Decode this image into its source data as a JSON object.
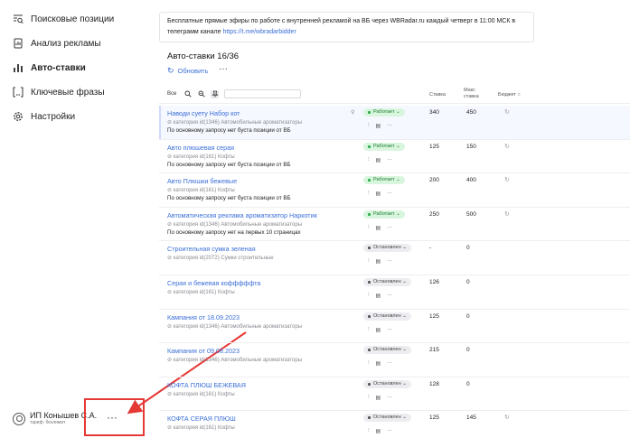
{
  "sidebar": {
    "items": [
      {
        "label": "Поисковые позиции",
        "icon": "search-list-icon"
      },
      {
        "label": "Анализ рекламы",
        "icon": "chart-doc-icon"
      },
      {
        "label": "Авто-ставки",
        "icon": "bar-chart-icon",
        "active": true
      },
      {
        "label": "Ключевые фразы",
        "icon": "brackets-icon"
      },
      {
        "label": "Настройки",
        "icon": "gear-icon"
      }
    ],
    "user": {
      "name": "ИП Конышев С.А.",
      "plan": "тариф: безлимит",
      "more": "···"
    }
  },
  "banner": {
    "text": "Бесплатные прямые эфиры по работе с внутренней рекламой на ВБ через WBRadar.ru каждый четверг в 11:00 МСК в телеграмм канале ",
    "link": "https://t.me/wbradarbidder"
  },
  "page": {
    "title": "Авто-ставки 16/36",
    "refresh": "Обновить",
    "more": "···",
    "filter_all": "Все"
  },
  "columns": {
    "bid": "Ставка",
    "max_bid_1": "Макс",
    "max_bid_2": "ставка",
    "budget": "Бюджет"
  },
  "rows": [
    {
      "name": "Наводи суету Набор кот",
      "category": "категория id(1346) Автомобильные ароматизаторы",
      "note": "По основному запросу нет буста позиции от ВБ",
      "status": "Работает",
      "running": true,
      "bid": "340",
      "max_bid": "450",
      "pinned": true
    },
    {
      "name": "Авто плюшевая серая",
      "category": "категория id(161) Кофты",
      "note": "По основному запросу нет буста позиции от ВБ",
      "status": "Работает",
      "running": true,
      "bid": "125",
      "max_bid": "150"
    },
    {
      "name": "Авто Плюшки бежевые",
      "category": "категория id(161) Кофты",
      "note": "По основному запросу нет буста позиции от ВБ",
      "status": "Работает",
      "running": true,
      "bid": "200",
      "max_bid": "400"
    },
    {
      "name": "Автоматическая реклама ароматизатор Наркотик",
      "category": "категория id(1346) Автомобильные ароматизаторы",
      "note": "По основному запросу нет на первых 10 страницах",
      "status": "Работает",
      "running": true,
      "bid": "250",
      "max_bid": "500"
    },
    {
      "name": "Строительная сумка зеленая",
      "category": "категория id(2072) Сумки строительные",
      "note": "",
      "status": "Остановлен",
      "running": false,
      "bid": "-",
      "max_bid": "0"
    },
    {
      "name": "Серая и бежевая кофффффта",
      "category": "категория id(161) Кофты",
      "note": "",
      "status": "Остановлен",
      "running": false,
      "bid": "126",
      "max_bid": "0"
    },
    {
      "name": "Кампания от 18.09.2023",
      "category": "категория id(1346) Автомобильные ароматизаторы",
      "note": "",
      "status": "Остановлен",
      "running": false,
      "bid": "125",
      "max_bid": "0"
    },
    {
      "name": "Кампания от 09.08.2023",
      "category": "категория id(1346) Автомобильные ароматизаторы",
      "note": "",
      "status": "Остановлен",
      "running": false,
      "bid": "215",
      "max_bid": "0"
    },
    {
      "name": "КОФТА ПЛЮШ БЕЖЕВАЯ",
      "category": "категория id(161) Кофты",
      "note": "",
      "status": "Остановлен",
      "running": false,
      "bid": "128",
      "max_bid": "0"
    },
    {
      "name": "КОФТА СЕРАЯ ПЛЮШ",
      "category": "категория id(161) Кофты",
      "note": "",
      "status": "Остановлен",
      "running": false,
      "bid": "125",
      "max_bid": "145"
    }
  ],
  "colors": {
    "accent": "#3b6fd8",
    "annotation": "#e53935",
    "running_bg": "#d8f5dd",
    "running_text": "#1d7b34",
    "stopped_bg": "#ededf1"
  }
}
